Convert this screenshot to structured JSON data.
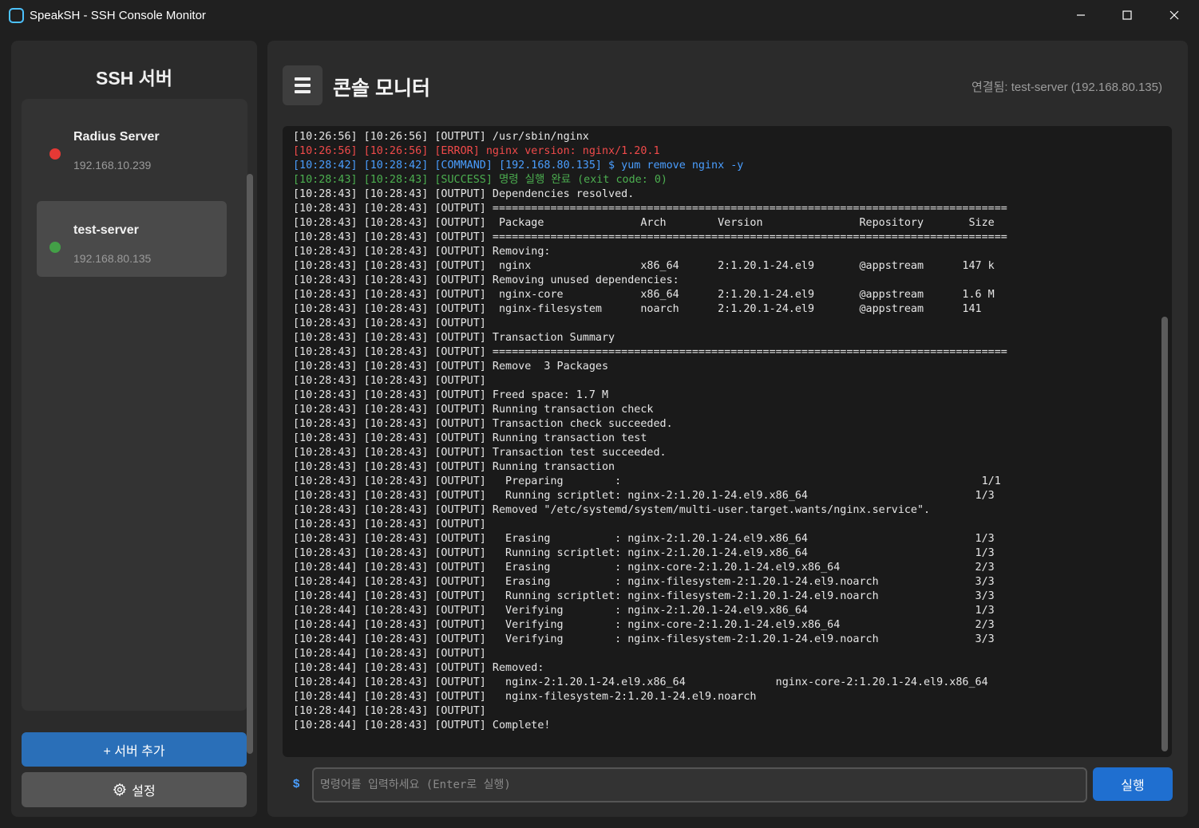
{
  "window": {
    "title": "SpeakSH - SSH Console Monitor"
  },
  "sidebar": {
    "title": "SSH 서버",
    "servers": [
      {
        "name": "Radius Server",
        "ip": "192.168.10.239",
        "status": "offline",
        "status_color": "#e53935"
      },
      {
        "name": "test-server",
        "ip": "192.168.80.135",
        "status": "online",
        "status_color": "#43a047",
        "selected": true
      }
    ],
    "add_button": "+ 서버 추가",
    "settings_button": "설정"
  },
  "main": {
    "title": "콘솔 모니터",
    "connection_status": "연결됨: test-server (192.168.80.135)",
    "colors": {
      "output": "#e6e6e6",
      "error": "#f04a4a",
      "command": "#4a9eff",
      "success": "#4caf50"
    },
    "console_lines": [
      {
        "type": "output",
        "text": "[10:26:56] [10:26:56] [OUTPUT] /usr/sbin/nginx"
      },
      {
        "type": "error",
        "text": "[10:26:56] [10:26:56] [ERROR] nginx version: nginx/1.20.1"
      },
      {
        "type": "command",
        "text": "[10:28:42] [10:28:42] [COMMAND] [192.168.80.135] $ yum remove nginx -y"
      },
      {
        "type": "success",
        "text": "[10:28:43] [10:28:43] [SUCCESS] 명령 실행 완료 (exit code: 0)"
      },
      {
        "type": "output",
        "text": "[10:28:43] [10:28:43] [OUTPUT] Dependencies resolved."
      },
      {
        "type": "output",
        "text": "[10:28:43] [10:28:43] [OUTPUT] ================================================================================"
      },
      {
        "type": "output",
        "text": "[10:28:43] [10:28:43] [OUTPUT]  Package               Arch        Version               Repository       Size"
      },
      {
        "type": "output",
        "text": "[10:28:43] [10:28:43] [OUTPUT] ================================================================================"
      },
      {
        "type": "output",
        "text": "[10:28:43] [10:28:43] [OUTPUT] Removing:"
      },
      {
        "type": "output",
        "text": "[10:28:43] [10:28:43] [OUTPUT]  nginx                 x86_64      2:1.20.1-24.el9       @appstream      147 k"
      },
      {
        "type": "output",
        "text": "[10:28:43] [10:28:43] [OUTPUT] Removing unused dependencies:"
      },
      {
        "type": "output",
        "text": "[10:28:43] [10:28:43] [OUTPUT]  nginx-core            x86_64      2:1.20.1-24.el9       @appstream      1.6 M"
      },
      {
        "type": "output",
        "text": "[10:28:43] [10:28:43] [OUTPUT]  nginx-filesystem      noarch      2:1.20.1-24.el9       @appstream      141"
      },
      {
        "type": "output",
        "text": "[10:28:43] [10:28:43] [OUTPUT]"
      },
      {
        "type": "output",
        "text": "[10:28:43] [10:28:43] [OUTPUT] Transaction Summary"
      },
      {
        "type": "output",
        "text": "[10:28:43] [10:28:43] [OUTPUT] ================================================================================"
      },
      {
        "type": "output",
        "text": "[10:28:43] [10:28:43] [OUTPUT] Remove  3 Packages"
      },
      {
        "type": "output",
        "text": "[10:28:43] [10:28:43] [OUTPUT]"
      },
      {
        "type": "output",
        "text": "[10:28:43] [10:28:43] [OUTPUT] Freed space: 1.7 M"
      },
      {
        "type": "output",
        "text": "[10:28:43] [10:28:43] [OUTPUT] Running transaction check"
      },
      {
        "type": "output",
        "text": "[10:28:43] [10:28:43] [OUTPUT] Transaction check succeeded."
      },
      {
        "type": "output",
        "text": "[10:28:43] [10:28:43] [OUTPUT] Running transaction test"
      },
      {
        "type": "output",
        "text": "[10:28:43] [10:28:43] [OUTPUT] Transaction test succeeded."
      },
      {
        "type": "output",
        "text": "[10:28:43] [10:28:43] [OUTPUT] Running transaction"
      },
      {
        "type": "output",
        "text": "[10:28:43] [10:28:43] [OUTPUT]   Preparing        :                                                        1/1"
      },
      {
        "type": "output",
        "text": "[10:28:43] [10:28:43] [OUTPUT]   Running scriptlet: nginx-2:1.20.1-24.el9.x86_64                          1/3"
      },
      {
        "type": "output",
        "text": "[10:28:43] [10:28:43] [OUTPUT] Removed \"/etc/systemd/system/multi-user.target.wants/nginx.service\"."
      },
      {
        "type": "output",
        "text": "[10:28:43] [10:28:43] [OUTPUT]"
      },
      {
        "type": "output",
        "text": "[10:28:43] [10:28:43] [OUTPUT]   Erasing          : nginx-2:1.20.1-24.el9.x86_64                          1/3"
      },
      {
        "type": "output",
        "text": "[10:28:43] [10:28:43] [OUTPUT]   Running scriptlet: nginx-2:1.20.1-24.el9.x86_64                          1/3"
      },
      {
        "type": "output",
        "text": "[10:28:44] [10:28:43] [OUTPUT]   Erasing          : nginx-core-2:1.20.1-24.el9.x86_64                     2/3"
      },
      {
        "type": "output",
        "text": "[10:28:44] [10:28:43] [OUTPUT]   Erasing          : nginx-filesystem-2:1.20.1-24.el9.noarch               3/3"
      },
      {
        "type": "output",
        "text": "[10:28:44] [10:28:43] [OUTPUT]   Running scriptlet: nginx-filesystem-2:1.20.1-24.el9.noarch               3/3"
      },
      {
        "type": "output",
        "text": "[10:28:44] [10:28:43] [OUTPUT]   Verifying        : nginx-2:1.20.1-24.el9.x86_64                          1/3"
      },
      {
        "type": "output",
        "text": "[10:28:44] [10:28:43] [OUTPUT]   Verifying        : nginx-core-2:1.20.1-24.el9.x86_64                     2/3"
      },
      {
        "type": "output",
        "text": "[10:28:44] [10:28:43] [OUTPUT]   Verifying        : nginx-filesystem-2:1.20.1-24.el9.noarch               3/3"
      },
      {
        "type": "output",
        "text": "[10:28:44] [10:28:43] [OUTPUT]"
      },
      {
        "type": "output",
        "text": "[10:28:44] [10:28:43] [OUTPUT] Removed:"
      },
      {
        "type": "output",
        "text": "[10:28:44] [10:28:43] [OUTPUT]   nginx-2:1.20.1-24.el9.x86_64              nginx-core-2:1.20.1-24.el9.x86_64"
      },
      {
        "type": "output",
        "text": "[10:28:44] [10:28:43] [OUTPUT]   nginx-filesystem-2:1.20.1-24.el9.noarch"
      },
      {
        "type": "output",
        "text": "[10:28:44] [10:28:43] [OUTPUT]"
      },
      {
        "type": "output",
        "text": "[10:28:44] [10:28:43] [OUTPUT] Complete!"
      }
    ],
    "prompt_symbol": "$",
    "command_placeholder": "명령어를 입력하세요 (Enter로 실행)",
    "command_value": "",
    "run_button": "실행"
  },
  "icons": {
    "app": "app-icon",
    "minimize": "minimize-icon",
    "maximize": "maximize-icon",
    "close": "close-icon",
    "menu": "menu-icon",
    "settings": "gear-icon"
  }
}
